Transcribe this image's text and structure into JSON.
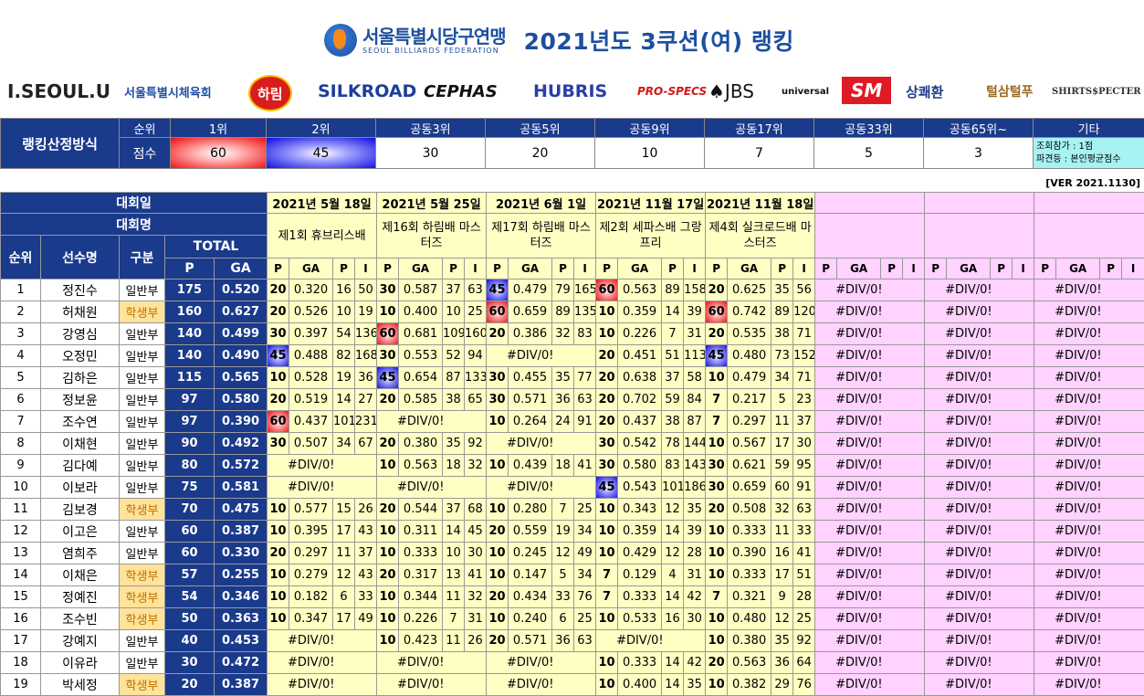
{
  "header": {
    "federation_ko": "서울특별시당구연맹",
    "federation_en": "SEOUL BILLIARDS FEDERATION",
    "title": "2021년도 3쿠션(여) 랭킹",
    "sponsors": [
      "I.SEOUL.U",
      "서울특별시체육회",
      "하림",
      "SILKROAD",
      "CEPHAS",
      "HUBRIS",
      "PRO-SPECS",
      "♠JBS",
      "universal",
      "SM",
      "상쾌환",
      "털삼털푸",
      "SHIRTS$PECTER"
    ]
  },
  "ranking_method": {
    "label": "랭킹산정방식",
    "rank_label": "순위",
    "score_label": "점수",
    "ranks": [
      "1위",
      "2위",
      "공동3위",
      "공동5위",
      "공동9위",
      "공동17위",
      "공동33위",
      "공동65위~"
    ],
    "scores": [
      "60",
      "45",
      "30",
      "20",
      "10",
      "7",
      "5",
      "3"
    ],
    "etc_label": "기타",
    "etc_lines": [
      "조회참가 : 1점",
      "파견등 : 본인평균점수"
    ]
  },
  "version": "[VER 2021.1130]",
  "table": {
    "date_label": "대회일",
    "name_label": "대회명",
    "rank_col": "순위",
    "player_col": "선수명",
    "div_col": "구분",
    "total_label": "TOTAL",
    "p_label": "P",
    "ga_label": "GA",
    "i_label": "I",
    "events": [
      {
        "date": "2021년 5월 18일",
        "name": "제1회 휴브리스배"
      },
      {
        "date": "2021년 5월 25일",
        "name": "제16회 하림배 마스터즈"
      },
      {
        "date": "2021년 6월 1일",
        "name": "제17회 하림배 마스터즈"
      },
      {
        "date": "2021년 11월 17일",
        "name": "제2회 세파스배 그랑프리"
      },
      {
        "date": "2021년 11월 18일",
        "name": "제4회 실크로드배 마스터즈"
      },
      {
        "date": "",
        "name": ""
      },
      {
        "date": "",
        "name": ""
      },
      {
        "date": "",
        "name": ""
      }
    ],
    "div_ref": "#DIV/0!",
    "rows": [
      {
        "rank": "1",
        "name": "정진수",
        "div": "일반부",
        "p": "175",
        "ga": "0.520",
        "ev": [
          [
            "20",
            "0.320",
            "16",
            "50"
          ],
          [
            "30",
            "0.587",
            "37",
            "63"
          ],
          [
            "45",
            "0.479",
            "79",
            "165"
          ],
          [
            "60",
            "0.563",
            "89",
            "158"
          ],
          [
            "20",
            "0.625",
            "35",
            "56"
          ]
        ]
      },
      {
        "rank": "2",
        "name": "허채원",
        "div": "학생부",
        "p": "160",
        "ga": "0.627",
        "ev": [
          [
            "20",
            "0.526",
            "10",
            "19"
          ],
          [
            "10",
            "0.400",
            "10",
            "25"
          ],
          [
            "60",
            "0.659",
            "89",
            "135"
          ],
          [
            "10",
            "0.359",
            "14",
            "39"
          ],
          [
            "60",
            "0.742",
            "89",
            "120"
          ]
        ]
      },
      {
        "rank": "3",
        "name": "강영심",
        "div": "일반부",
        "p": "140",
        "ga": "0.499",
        "ev": [
          [
            "30",
            "0.397",
            "54",
            "136"
          ],
          [
            "60",
            "0.681",
            "109",
            "160"
          ],
          [
            "20",
            "0.386",
            "32",
            "83"
          ],
          [
            "10",
            "0.226",
            "7",
            "31"
          ],
          [
            "20",
            "0.535",
            "38",
            "71"
          ]
        ]
      },
      {
        "rank": "4",
        "name": "오정민",
        "div": "일반부",
        "p": "140",
        "ga": "0.490",
        "ev": [
          [
            "45",
            "0.488",
            "82",
            "168"
          ],
          [
            "30",
            "0.553",
            "52",
            "94"
          ],
          [
            "",
            "#DIV/0!",
            "",
            ""
          ],
          [
            "20",
            "0.451",
            "51",
            "113"
          ],
          [
            "45",
            "0.480",
            "73",
            "152"
          ]
        ]
      },
      {
        "rank": "5",
        "name": "김하은",
        "div": "일반부",
        "p": "115",
        "ga": "0.565",
        "ev": [
          [
            "10",
            "0.528",
            "19",
            "36"
          ],
          [
            "45",
            "0.654",
            "87",
            "133"
          ],
          [
            "30",
            "0.455",
            "35",
            "77"
          ],
          [
            "20",
            "0.638",
            "37",
            "58"
          ],
          [
            "10",
            "0.479",
            "34",
            "71"
          ]
        ]
      },
      {
        "rank": "6",
        "name": "정보윤",
        "div": "일반부",
        "p": "97",
        "ga": "0.580",
        "ev": [
          [
            "20",
            "0.519",
            "14",
            "27"
          ],
          [
            "20",
            "0.585",
            "38",
            "65"
          ],
          [
            "30",
            "0.571",
            "36",
            "63"
          ],
          [
            "20",
            "0.702",
            "59",
            "84"
          ],
          [
            "7",
            "0.217",
            "5",
            "23"
          ]
        ]
      },
      {
        "rank": "7",
        "name": "조수연",
        "div": "일반부",
        "p": "97",
        "ga": "0.390",
        "ev": [
          [
            "60",
            "0.437",
            "101",
            "231"
          ],
          [
            "",
            "#DIV/0!",
            "",
            ""
          ],
          [
            "10",
            "0.264",
            "24",
            "91"
          ],
          [
            "20",
            "0.437",
            "38",
            "87"
          ],
          [
            "7",
            "0.297",
            "11",
            "37"
          ]
        ]
      },
      {
        "rank": "8",
        "name": "이채현",
        "div": "일반부",
        "p": "90",
        "ga": "0.492",
        "ev": [
          [
            "30",
            "0.507",
            "34",
            "67"
          ],
          [
            "20",
            "0.380",
            "35",
            "92"
          ],
          [
            "",
            "#DIV/0!",
            "",
            ""
          ],
          [
            "30",
            "0.542",
            "78",
            "144"
          ],
          [
            "10",
            "0.567",
            "17",
            "30"
          ]
        ]
      },
      {
        "rank": "9",
        "name": "김다예",
        "div": "일반부",
        "p": "80",
        "ga": "0.572",
        "ev": [
          [
            "",
            "#DIV/0!",
            "",
            ""
          ],
          [
            "10",
            "0.563",
            "18",
            "32"
          ],
          [
            "10",
            "0.439",
            "18",
            "41"
          ],
          [
            "30",
            "0.580",
            "83",
            "143"
          ],
          [
            "30",
            "0.621",
            "59",
            "95"
          ]
        ]
      },
      {
        "rank": "10",
        "name": "이보라",
        "div": "일반부",
        "p": "75",
        "ga": "0.581",
        "ev": [
          [
            "",
            "#DIV/0!",
            "",
            ""
          ],
          [
            "",
            "#DIV/0!",
            "",
            ""
          ],
          [
            "",
            "#DIV/0!",
            "",
            ""
          ],
          [
            "45",
            "0.543",
            "101",
            "186"
          ],
          [
            "30",
            "0.659",
            "60",
            "91"
          ]
        ]
      },
      {
        "rank": "11",
        "name": "김보경",
        "div": "학생부",
        "p": "70",
        "ga": "0.475",
        "ev": [
          [
            "10",
            "0.577",
            "15",
            "26"
          ],
          [
            "20",
            "0.544",
            "37",
            "68"
          ],
          [
            "10",
            "0.280",
            "7",
            "25"
          ],
          [
            "10",
            "0.343",
            "12",
            "35"
          ],
          [
            "20",
            "0.508",
            "32",
            "63"
          ]
        ]
      },
      {
        "rank": "12",
        "name": "이고은",
        "div": "일반부",
        "p": "60",
        "ga": "0.387",
        "ev": [
          [
            "10",
            "0.395",
            "17",
            "43"
          ],
          [
            "10",
            "0.311",
            "14",
            "45"
          ],
          [
            "20",
            "0.559",
            "19",
            "34"
          ],
          [
            "10",
            "0.359",
            "14",
            "39"
          ],
          [
            "10",
            "0.333",
            "11",
            "33"
          ]
        ]
      },
      {
        "rank": "13",
        "name": "염희주",
        "div": "일반부",
        "p": "60",
        "ga": "0.330",
        "ev": [
          [
            "20",
            "0.297",
            "11",
            "37"
          ],
          [
            "10",
            "0.333",
            "10",
            "30"
          ],
          [
            "10",
            "0.245",
            "12",
            "49"
          ],
          [
            "10",
            "0.429",
            "12",
            "28"
          ],
          [
            "10",
            "0.390",
            "16",
            "41"
          ]
        ]
      },
      {
        "rank": "14",
        "name": "이채은",
        "div": "학생부",
        "p": "57",
        "ga": "0.255",
        "ev": [
          [
            "10",
            "0.279",
            "12",
            "43"
          ],
          [
            "20",
            "0.317",
            "13",
            "41"
          ],
          [
            "10",
            "0.147",
            "5",
            "34"
          ],
          [
            "7",
            "0.129",
            "4",
            "31"
          ],
          [
            "10",
            "0.333",
            "17",
            "51"
          ]
        ]
      },
      {
        "rank": "15",
        "name": "정예진",
        "div": "학생부",
        "p": "54",
        "ga": "0.346",
        "ev": [
          [
            "10",
            "0.182",
            "6",
            "33"
          ],
          [
            "10",
            "0.344",
            "11",
            "32"
          ],
          [
            "20",
            "0.434",
            "33",
            "76"
          ],
          [
            "7",
            "0.333",
            "14",
            "42"
          ],
          [
            "7",
            "0.321",
            "9",
            "28"
          ]
        ]
      },
      {
        "rank": "16",
        "name": "조수빈",
        "div": "학생부",
        "p": "50",
        "ga": "0.363",
        "ev": [
          [
            "10",
            "0.347",
            "17",
            "49"
          ],
          [
            "10",
            "0.226",
            "7",
            "31"
          ],
          [
            "10",
            "0.240",
            "6",
            "25"
          ],
          [
            "10",
            "0.533",
            "16",
            "30"
          ],
          [
            "10",
            "0.480",
            "12",
            "25"
          ]
        ]
      },
      {
        "rank": "17",
        "name": "강예지",
        "div": "일반부",
        "p": "40",
        "ga": "0.453",
        "ev": [
          [
            "",
            "#DIV/0!",
            "",
            ""
          ],
          [
            "10",
            "0.423",
            "11",
            "26"
          ],
          [
            "20",
            "0.571",
            "36",
            "63"
          ],
          [
            "",
            "#DIV/0!",
            "",
            ""
          ],
          [
            "10",
            "0.380",
            "35",
            "92"
          ]
        ]
      },
      {
        "rank": "18",
        "name": "이유라",
        "div": "일반부",
        "p": "30",
        "ga": "0.472",
        "ev": [
          [
            "",
            "#DIV/0!",
            "",
            ""
          ],
          [
            "",
            "#DIV/0!",
            "",
            ""
          ],
          [
            "",
            "#DIV/0!",
            "",
            ""
          ],
          [
            "10",
            "0.333",
            "14",
            "42"
          ],
          [
            "20",
            "0.563",
            "36",
            "64"
          ]
        ]
      },
      {
        "rank": "19",
        "name": "박세정",
        "div": "학생부",
        "p": "20",
        "ga": "0.387",
        "ev": [
          [
            "",
            "#DIV/0!",
            "",
            ""
          ],
          [
            "",
            "#DIV/0!",
            "",
            ""
          ],
          [
            "",
            "#DIV/0!",
            "",
            ""
          ],
          [
            "10",
            "0.400",
            "14",
            "35"
          ],
          [
            "10",
            "0.382",
            "29",
            "76"
          ]
        ]
      }
    ]
  }
}
